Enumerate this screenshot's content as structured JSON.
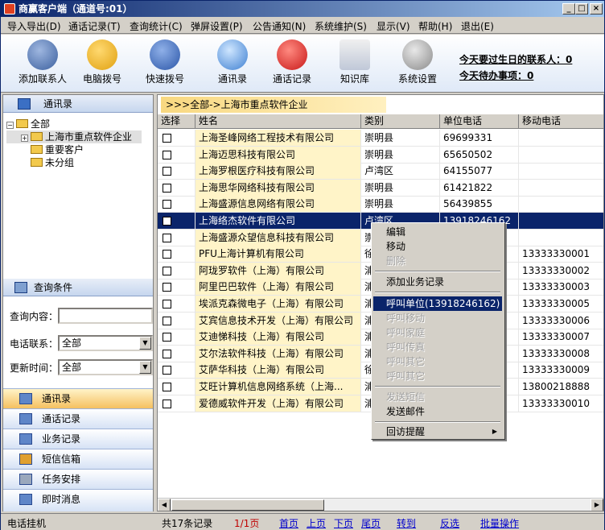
{
  "window": {
    "title": "商赢客户端（通道号:01）",
    "minimize": "_",
    "maximize": "□",
    "close": "×"
  },
  "menu": [
    "导入导出(D)",
    "通话记录(T)",
    "查询统计(C)",
    "弹屏设置(P)",
    "公告通知(N)",
    "系统维护(S)",
    "显示(V)",
    "帮助(H)",
    "退出(E)"
  ],
  "toolbar": [
    {
      "label": "添加联系人",
      "icon": "add-contact-icon"
    },
    {
      "label": "电脑拨号",
      "icon": "phone-dial-icon"
    },
    {
      "label": "快速拨号",
      "icon": "quick-dial-icon"
    },
    {
      "label": "通讯录",
      "icon": "address-book-icon"
    },
    {
      "label": "通话记录",
      "icon": "call-record-icon"
    },
    {
      "label": "知识库",
      "icon": "knowledge-icon"
    },
    {
      "label": "系统设置",
      "icon": "settings-icon"
    }
  ],
  "notices": {
    "birthday": "今天要过生日的联系人：0",
    "todo": "今天待办事项：0"
  },
  "left": {
    "header": "通讯录",
    "tree": {
      "root": "全部",
      "child1": "上海市重点软件企业",
      "child2": "重要客户",
      "child3": "未分组",
      "toggle1": "−",
      "toggle2": "+"
    },
    "query": {
      "header": "查询条件",
      "content_label": "查询内容：",
      "content_value": "",
      "phone_label": "电话联系：",
      "phone_value": "全部",
      "time_label": "更新时间：",
      "time_value": "全部"
    },
    "nav": [
      "通讯录",
      "通话记录",
      "业务记录",
      "短信信箱",
      "任务安排",
      "即时消息"
    ]
  },
  "breadcrumb": ">>>全部->上海市重点软件企业",
  "table": {
    "headers": [
      "选择",
      "姓名",
      "类别",
      "单位电话",
      "移动电话"
    ],
    "rows": [
      {
        "name": "上海圣峰网络工程技术有限公司",
        "cat": "崇明县",
        "tel": "69699331",
        "mob": ""
      },
      {
        "name": "上海迈思科技有限公司",
        "cat": "崇明县",
        "tel": "65650502",
        "mob": ""
      },
      {
        "name": "上海罗根医疗科技有限公司",
        "cat": "卢湾区",
        "tel": "64155077",
        "mob": ""
      },
      {
        "name": "上海思华网络科技有限公司",
        "cat": "崇明县",
        "tel": "61421822",
        "mob": ""
      },
      {
        "name": "上海盛源信息网络有限公司",
        "cat": "崇明县",
        "tel": "56439855",
        "mob": ""
      },
      {
        "name": "上海络杰软件有限公司",
        "cat": "卢湾区",
        "tel": "13918246162",
        "mob": ""
      },
      {
        "name": "上海盛源众望信息科技有限公司",
        "cat": "崇",
        "tel": "",
        "mob": ""
      },
      {
        "name": "PFU上海计算机有限公司",
        "cat": "徐",
        "tel": "",
        "mob": "13333330001"
      },
      {
        "name": "阿珑罗软件（上海）有限公司",
        "cat": "浦",
        "tel": "",
        "mob": "13333330002"
      },
      {
        "name": "阿里巴巴软件（上海）有限公司",
        "cat": "浦",
        "tel": "",
        "mob": "13333330003"
      },
      {
        "name": "埃派克森微电子（上海）有限公司",
        "cat": "浦",
        "tel": "",
        "mob": "13333330005"
      },
      {
        "name": "艾宾信息技术开发（上海）有限公司",
        "cat": "浦",
        "tel": "",
        "mob": "13333330006"
      },
      {
        "name": "艾迪悌科技（上海）有限公司",
        "cat": "浦",
        "tel": "",
        "mob": "13333330007"
      },
      {
        "name": "艾尔法软件科技（上海）有限公司",
        "cat": "浦",
        "tel": "",
        "mob": "13333330008"
      },
      {
        "name": "艾萨华科技（上海）有限公司",
        "cat": "徐",
        "tel": "",
        "mob": "13333330009"
      },
      {
        "name": "艾旺计算机信息网络系统（上海...",
        "cat": "浦",
        "tel": "",
        "mob": "13800218888"
      },
      {
        "name": "爱德威软件开发（上海）有限公司",
        "cat": "浦",
        "tel": "",
        "mob": "13333330010"
      }
    ]
  },
  "context_menu": {
    "edit": "编辑",
    "move": "移动",
    "delete": "删除",
    "add_business": "添加业务记录",
    "call_unit": "呼叫单位(13918246162)",
    "call_mobile": "呼叫移动",
    "call_home": "呼叫家庭",
    "call_fax": "呼叫传真",
    "call_other1": "呼叫其它",
    "call_other2": "呼叫其它",
    "send_sms": "发送短信",
    "send_mail": "发送邮件",
    "reminder": "回访提醒",
    "submenu_arrow": "▶"
  },
  "status": {
    "hangup": "电话挂机",
    "total": "共17条记录",
    "page": "1/1页",
    "first": "首页",
    "prev": "上页",
    "next": "下页",
    "last": "尾页",
    "goto": "转到",
    "invert": "反选",
    "batch": "批量操作"
  }
}
